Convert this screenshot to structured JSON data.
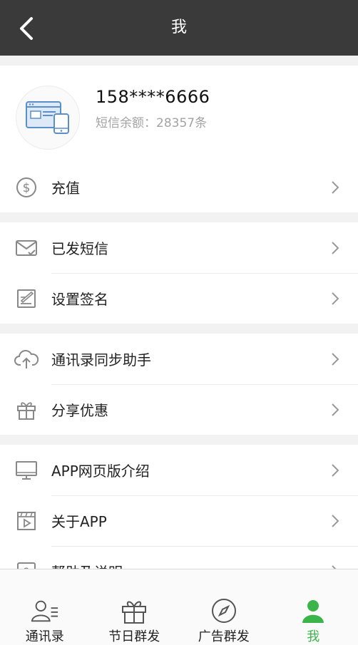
{
  "header": {
    "title": "我"
  },
  "profile": {
    "phone": "158****6666",
    "sms_label": "短信余额：",
    "sms_count": "28357条"
  },
  "menu": {
    "recharge": "充值",
    "sent_sms": "已发短信",
    "signature": "设置签名",
    "contacts_sync": "通讯录同步助手",
    "share": "分享优惠",
    "web_intro": "APP网页版介绍",
    "about": "关于APP",
    "help": "帮助及说明"
  },
  "tabs": {
    "contacts": "通讯录",
    "holiday": "节日群发",
    "ads": "广告群发",
    "me": "我"
  },
  "colors": {
    "accent": "#3bb54a",
    "topbar": "#3a3a3a"
  }
}
